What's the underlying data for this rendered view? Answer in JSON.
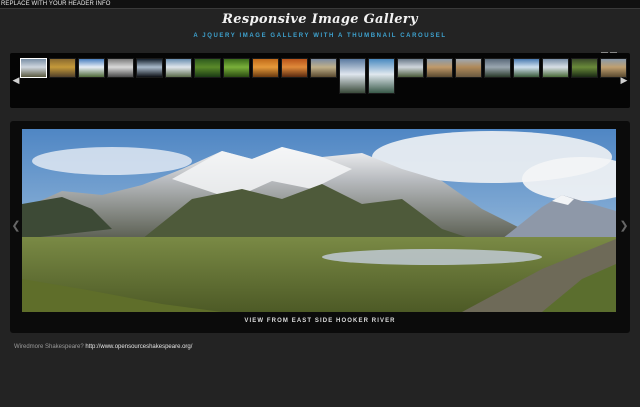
{
  "top_bar": {
    "text": "REPLACE WITH YOUR HEADER INFO"
  },
  "header": {
    "title": "Responsive Image Gallery",
    "subtitle": "A JQUERY IMAGE GALLERY WITH A THUMBNAIL CAROUSEL"
  },
  "view_toggle_icons": [
    "fullview-icon",
    "thumbview-icon"
  ],
  "thumbnails": [
    {
      "label": "thumb-01",
      "colors": [
        "#7a8fa6",
        "#cfd6de",
        "#5a5a40"
      ],
      "active": true
    },
    {
      "label": "thumb-02",
      "colors": [
        "#8a6a30",
        "#c59a3a",
        "#50402a"
      ]
    },
    {
      "label": "thumb-03",
      "colors": [
        "#4a7fbf",
        "#e7eef5",
        "#4f6a3a"
      ]
    },
    {
      "label": "thumb-04",
      "colors": [
        "#7c7c7c",
        "#d9d9d9",
        "#4a4a4a"
      ]
    },
    {
      "label": "thumb-05",
      "colors": [
        "#15202c",
        "#aabbcc",
        "#0d1015"
      ]
    },
    {
      "label": "thumb-06",
      "colors": [
        "#6a8fb0",
        "#e0e6ec",
        "#5a6a4a"
      ]
    },
    {
      "label": "thumb-07",
      "colors": [
        "#2e5a1e",
        "#5a8a2a",
        "#1a3a14"
      ]
    },
    {
      "label": "thumb-08",
      "colors": [
        "#3a6a1a",
        "#7ab03a",
        "#2a4a12"
      ]
    },
    {
      "label": "thumb-09",
      "colors": [
        "#c06a1a",
        "#e59a3a",
        "#6a3a10"
      ]
    },
    {
      "label": "thumb-10",
      "colors": [
        "#b8541a",
        "#e08a3a",
        "#5a2a10"
      ]
    },
    {
      "label": "thumb-11",
      "colors": [
        "#7a8aa0",
        "#c0b08a",
        "#5a4a30"
      ]
    },
    {
      "label": "thumb-12",
      "colors": [
        "#5a7aa0",
        "#dfe6ee",
        "#3a4a3a"
      ],
      "tall": true
    },
    {
      "label": "thumb-13",
      "colors": [
        "#4a8ac0",
        "#e0e8ef",
        "#3a5a4a"
      ],
      "tall": true
    },
    {
      "label": "thumb-14",
      "colors": [
        "#6a7a8a",
        "#d0d6dc",
        "#4a5a3a"
      ]
    },
    {
      "label": "thumb-15",
      "colors": [
        "#8a9aaa",
        "#c09a6a",
        "#5a4a30"
      ]
    },
    {
      "label": "thumb-16",
      "colors": [
        "#a0a8b0",
        "#b08a5a",
        "#6a5a40"
      ]
    },
    {
      "label": "thumb-17",
      "colors": [
        "#5a6a7a",
        "#9aa6b0",
        "#2a3a2a"
      ]
    },
    {
      "label": "thumb-18",
      "colors": [
        "#4a7ab0",
        "#cfe0ef",
        "#3a5a3a"
      ]
    },
    {
      "label": "thumb-19",
      "colors": [
        "#7a90a8",
        "#d8dfe6",
        "#4a6a3a"
      ]
    },
    {
      "label": "thumb-20",
      "colors": [
        "#3a4a2a",
        "#6a8a3a",
        "#1a2a14"
      ]
    },
    {
      "label": "thumb-21",
      "colors": [
        "#8a9aaa",
        "#c0a070",
        "#5a4a30"
      ]
    }
  ],
  "main": {
    "caption": "VIEW FROM EAST SIDE HOOKER RIVER"
  },
  "footer": {
    "text": "Wiredmore Shakespeare?",
    "link": "http://www.opensourceshakespeare.org/"
  },
  "colors": {
    "background": "#232323",
    "accent": "#3ea3d0",
    "panel": "#0b0b0b"
  }
}
